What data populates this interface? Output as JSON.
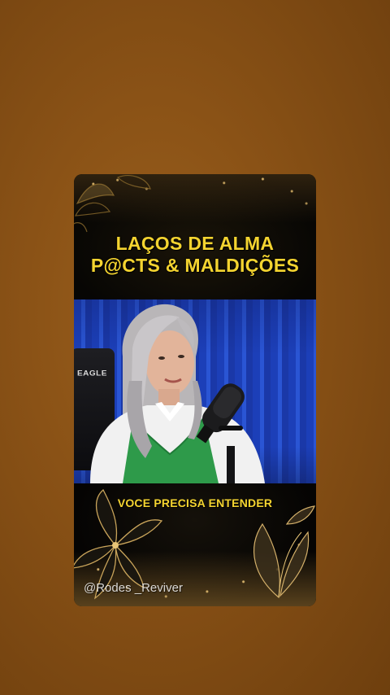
{
  "post": {
    "title_line1": "LAÇOS DE ALMA",
    "title_line2": "P@CTS & MALDIÇÕES",
    "subtitle": "VOCE PRECISA ENTENDER",
    "watermark": "@Rodes _Reviver",
    "chair_brand": "EAGLE"
  },
  "colors": {
    "background": "#8a5216",
    "title_text": "#f4d430",
    "video_backdrop": "#2a55d4",
    "sweater": "#2e9a4a"
  },
  "icons": {
    "top_left_ornament": "gold-flower-icon",
    "bottom_left_ornament": "gold-lily-icon",
    "bottom_right_ornament": "gold-leaf-icon",
    "microphone": "microphone-icon"
  }
}
